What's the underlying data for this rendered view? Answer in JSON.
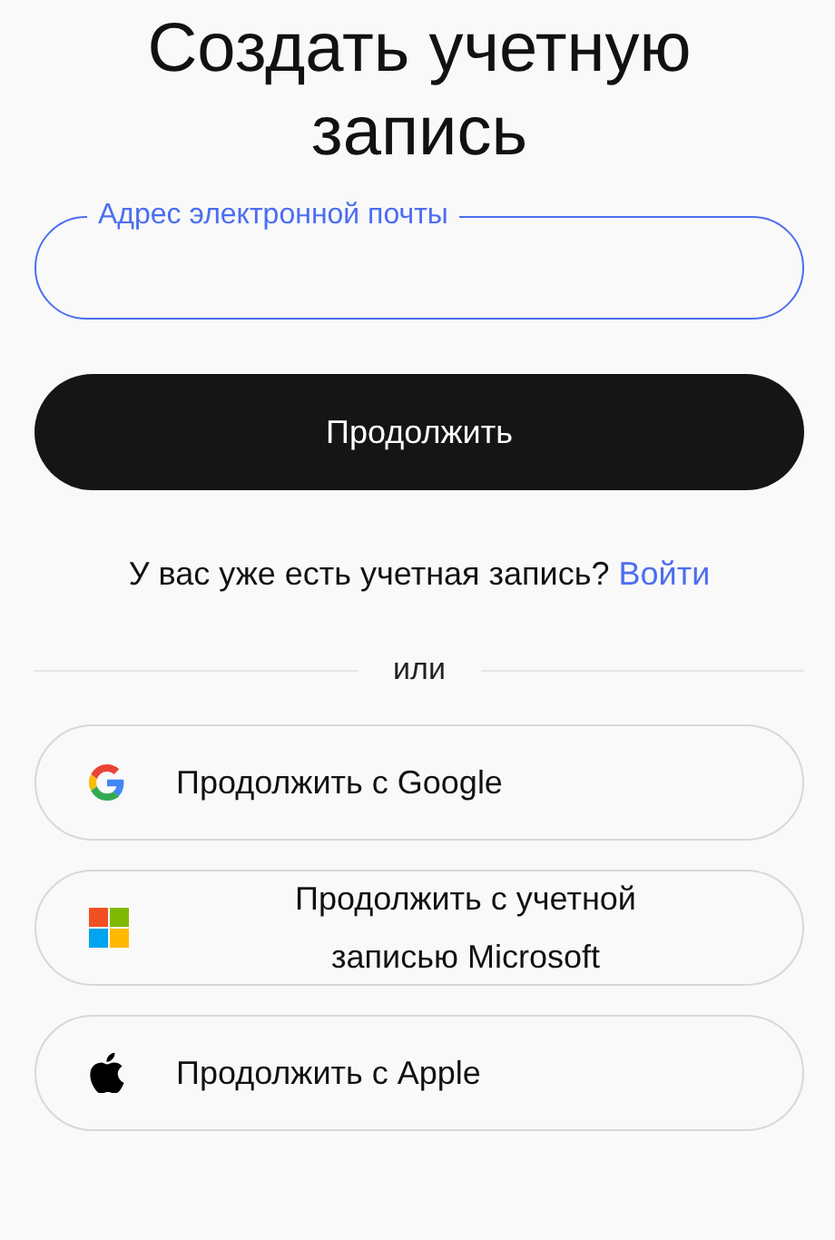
{
  "title": "Создать учетную запись",
  "email_field": {
    "label": "Адрес электронной почты"
  },
  "continue_button": "Продолжить",
  "login_prompt": {
    "text": "У вас уже есть учетная запись?",
    "link": "Войти"
  },
  "divider": "или",
  "providers": [
    {
      "kind": "google",
      "label": "Продолжить с Google"
    },
    {
      "kind": "microsoft",
      "label": "Продолжить с учетной записью Microsoft"
    },
    {
      "kind": "apple",
      "label": "Продолжить с Apple"
    }
  ]
}
